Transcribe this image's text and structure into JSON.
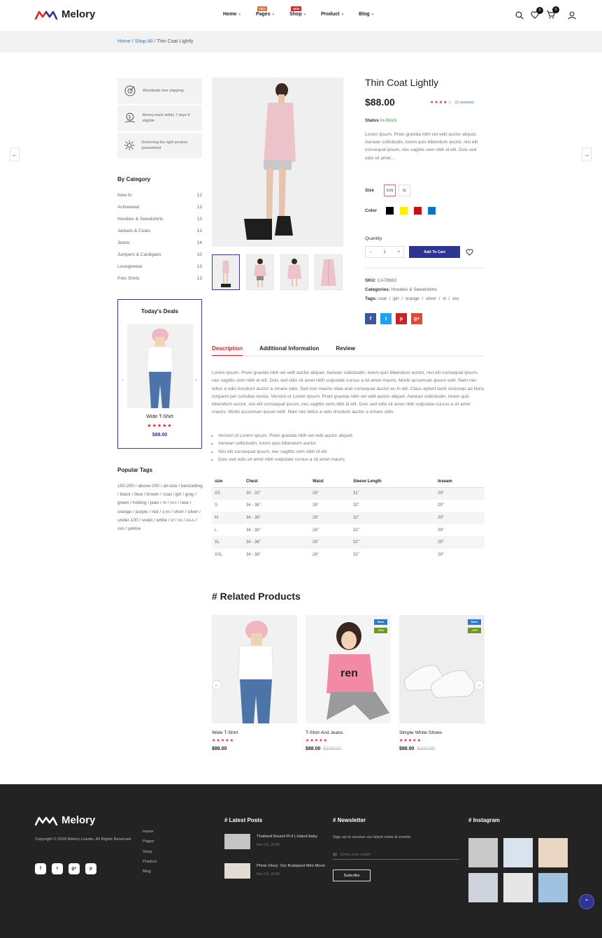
{
  "header": {
    "logo": "Melory",
    "nav": [
      {
        "label": "Home",
        "badge": ""
      },
      {
        "label": "Pages",
        "badge": "HOT"
      },
      {
        "label": "Shop",
        "badge": "NEW"
      },
      {
        "label": "Product",
        "badge": ""
      },
      {
        "label": "Blog",
        "badge": ""
      }
    ],
    "wishlist_count": "0",
    "cart_count": "0"
  },
  "breadcrumb": {
    "home": "Home",
    "shop": "Shop All",
    "current": "Thin Coat Lightly",
    "sep": "/"
  },
  "features": [
    {
      "icon": "shipping-icon",
      "text": "Worldwide free shipping"
    },
    {
      "icon": "money-back-icon",
      "text": "Money-back within 7 days if eligible"
    },
    {
      "icon": "delivery-icon",
      "text": "Delivering the right product guaranteed"
    }
  ],
  "categories": {
    "title": "By Category",
    "items": [
      {
        "label": "New In",
        "count": "12"
      },
      {
        "label": "Activewear",
        "count": "13"
      },
      {
        "label": "Hoodies & Sweatshirts",
        "count": "12"
      },
      {
        "label": "Jackets & Coats",
        "count": "13"
      },
      {
        "label": "Jeans",
        "count": "14"
      },
      {
        "label": "Jumpers & Cardigans",
        "count": "10"
      },
      {
        "label": "Loungewear",
        "count": "13"
      },
      {
        "label": "Polo Shirts",
        "count": "13"
      }
    ]
  },
  "deals": {
    "title": "Today's Deals",
    "name": "Wide T-Shirt",
    "rating": 5,
    "price": "$88.00"
  },
  "popular_tags": {
    "title": "Popular Tags",
    "text": "100-200 / above-200 / all-size / bestselling / black / blue / brown / coat / girl / gray / green / hotting / jean / m / m-l / new / orange / purple / red / s-m / short / silver / under-100 / violet / white / xl / xs / xs-s / xxs / yellow"
  },
  "product": {
    "title": "Thin Coat Lightly",
    "price": "$88.00",
    "rating": 4.5,
    "reviews": "(2 reviews)",
    "status_label": "Status",
    "status": "In-Stock",
    "description": "Lorem Ipsum. Proin gravida nibh vel velit auctor aliquet. Aenean sollicitudin, lorem quis bibendum auctor, nisi elit consequat ipsum, nec sagittis sem nibh id elit. Duis sed odio sit amet...",
    "size_label": "Size",
    "sizes": [
      "XXS",
      "XL"
    ],
    "selected_size": "XXS",
    "color_label": "Color",
    "colors": [
      "#000000",
      "#ffee00",
      "#c80f19",
      "#0a74c9"
    ],
    "quantity_label": "Quantity",
    "quantity": "1",
    "add_to_cart": "Add To Cart",
    "sku_label": "SKU:",
    "sku": "CA78963",
    "categories_label": "Categories:",
    "categories": "Hoodies & Sweatshirts",
    "tags_label": "Tags:",
    "tags": "coat  /  girl  /  orange  /  silver  /  xl  /  xxs"
  },
  "social": [
    {
      "icon": "facebook-icon",
      "glyph": "f",
      "color": "#3b5998"
    },
    {
      "icon": "twitter-icon",
      "glyph": "t",
      "color": "#1da1f2"
    },
    {
      "icon": "pinterest-icon",
      "glyph": "p",
      "color": "#c8232c"
    },
    {
      "icon": "google-plus-icon",
      "glyph": "g+",
      "color": "#dd4b39"
    }
  ],
  "tabs": [
    {
      "label": "Description",
      "active": true
    },
    {
      "label": "Additional Information",
      "active": false
    },
    {
      "label": "Review",
      "active": false
    }
  ],
  "description_text": "Lorem Ipsum. Proin gravida nibh vel velit auctor aliquet. Aenean sollicitudin, lorem quis bibendum auctor, nisi elit consequat ipsum, nec sagittis sem nibh id elit. Duis sed odio sit amet nibh vulputate cursus a sit amet mauris. Morbi accumsan ipsum velit. Nam nec tellus a odio tincidunt auctor a ornare odio. Sed non mauris vitae erat consequat auctor eu in elit. Class aptent taciti sociosqu ad litora torquent per conubia nostra. Version of Lorem Ipsum. Proin gravida nibh vel velit auctor aliquet. Aenean sollicitudin, lorem quis bibendum auctor, nisi elit consequat ipsum, nec sagittis sem nibh id elit. Duis sed odio sit amet nibh vulputate cursus a sit amet mauris. Morbi accumsan ipsum velit. Nam nec tellus a odio tincidunt auctor a ornare odio.",
  "bullets": [
    "Version of Lorem Ipsum. Proin gravida nibh vel velit auctor aliquet.",
    "Aenean sollicitudin, lorem quis bibendum auctor",
    "Nisi elit consequat ipsum, nec sagittis sem nibh id elit",
    "Duis sed odio sit amet nibh vulputate cursus a sit amet mauris"
  ],
  "size_table": {
    "headers": [
      "size",
      "Chest",
      "Waist",
      "Sleeve Length",
      "Inseam"
    ],
    "rows": [
      [
        "XS",
        "30 - 32\"",
        "26\"",
        "31\"",
        "29\""
      ],
      [
        "S",
        "34 - 36\"",
        "26\"",
        "32\"",
        "29\""
      ],
      [
        "M",
        "34 - 36\"",
        "26\"",
        "32\"",
        "29\""
      ],
      [
        "L",
        "34 - 36\"",
        "26\"",
        "32\"",
        "29\""
      ],
      [
        "XL",
        "34 - 36\"",
        "26\"",
        "32\"",
        "29\""
      ],
      [
        "XXL",
        "34 - 36\"",
        "26\"",
        "32\"",
        "29\""
      ]
    ]
  },
  "related": {
    "title": "# Related Products",
    "items": [
      {
        "name": "Wide T-Shirt",
        "price": "$88.00",
        "old_price": "",
        "badge": "",
        "discount": ""
      },
      {
        "name": "T-Shirt And Jeans",
        "price": "$88.00",
        "old_price": "$100.00",
        "badge": "Bost",
        "discount": "-12%"
      },
      {
        "name": "Simple White Shoes",
        "price": "$88.00",
        "old_price": "$100.00",
        "badge": "Bost",
        "discount": "-12%"
      }
    ]
  },
  "footer": {
    "logo": "Melory",
    "copyright": "Copyright © 2018 Melory Loader. All Rights Reserved",
    "links": [
      "Home",
      "Pages",
      "Shop",
      "Product",
      "Blog"
    ],
    "social": [
      "f",
      "t",
      "g+",
      "p"
    ],
    "posts_title": "# Latest Posts",
    "posts": [
      {
        "title": "Thailand Bound Pt.4 | Island baby",
        "date": "Nov 01, 2018"
      },
      {
        "title": "Photo Diary: Our Budapest Mini-Moon",
        "date": "Nov 01, 2018"
      }
    ],
    "newsletter_title": "# Newsletter",
    "newsletter_text": "Sign up to receive our latest news & events",
    "email_placeholder": "Enter your email",
    "subscribe": "Subcribe",
    "instagram_title": "# Instagram",
    "instagram_colors": [
      "#c9c9c9",
      "#d9e3ee",
      "#e9d7c4",
      "#cfd4dc",
      "#e6e6e6",
      "#9fc2e0"
    ]
  },
  "colors": {
    "accent": "#2d3590",
    "red": "#e0262b",
    "instock": "#2aa04a",
    "link": "#2b78d0"
  }
}
